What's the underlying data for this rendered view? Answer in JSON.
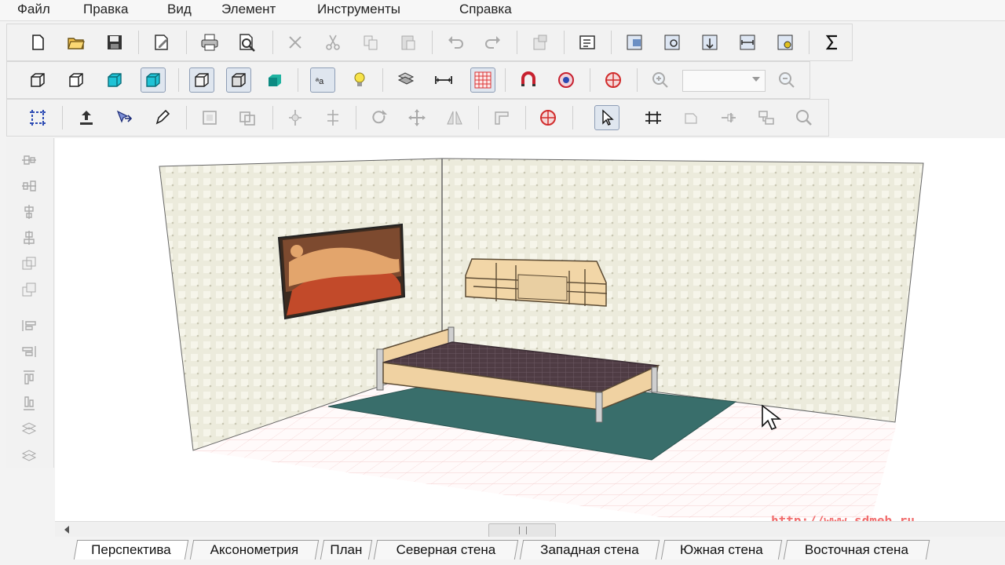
{
  "menu": [
    "Файл",
    "Правка",
    "Вид",
    "Элемент",
    "Инструменты",
    "Справка"
  ],
  "toolbar": {
    "row1_icons": [
      "new-file-icon",
      "open-folder-icon",
      "save-icon",
      "edit-document-icon",
      "print-icon",
      "print-preview-icon",
      "delete-icon",
      "cut-icon",
      "copy-icon",
      "paste-icon",
      "undo-icon",
      "redo-icon",
      "properties-icon",
      "report-icon",
      "view-icon-1",
      "view-icon-2",
      "view-icon-3",
      "view-icon-4",
      "view-icon-5",
      "sigma-icon"
    ],
    "row2_icons": [
      "wireframe-box-icon",
      "box-icon",
      "shaded-box-icon",
      "textured-box-icon",
      "box-outline-icon",
      "box-wire-icon",
      "solid-box-icon",
      "text-label-icon",
      "light-bulb-icon",
      "material-icon",
      "dimension-icon",
      "grid-icon",
      "magnet-icon",
      "target-icon",
      "crosshair-icon",
      "zoom-in-icon",
      "zoom-out-icon"
    ],
    "row3_icons": [
      "select-grid-icon",
      "move-up-icon",
      "move-arrow-icon",
      "edit-pen-icon",
      "rect-select-icon",
      "multi-select-icon",
      "align-icon-1",
      "align-icon-2",
      "rotate-icon",
      "move-cross-icon",
      "mirror-icon",
      "corner-icon",
      "snap-target-icon",
      "pointer-icon",
      "dimension-bars-icon",
      "shape-icon",
      "connect-icon",
      "node-icon",
      "search-icon"
    ],
    "zoom_value": ""
  },
  "sidebar_icons": [
    "side-tool-1-icon",
    "side-tool-2-icon",
    "side-tool-3-icon",
    "side-tool-4-icon",
    "side-tool-5-icon",
    "side-tool-6-icon",
    "side-tool-7-icon",
    "side-tool-8-icon",
    "side-tool-9-icon",
    "side-tool-10-icon",
    "side-tool-11-icon",
    "side-tool-12-icon"
  ],
  "tabs": [
    "Перспектива",
    "Аксонометрия",
    "План",
    "Северная стена",
    "Западная стена",
    "Южная стена",
    "Восточная стена"
  ],
  "active_tab": "Перспектива",
  "watermark": "http://www.sdmeb.ru",
  "colors": {
    "wall": "#ecebdc",
    "floor_grid": "#f3c9c9",
    "rug": "#396e6b",
    "bed_frame": "#f0d2a2",
    "mattress": "#4f3c44",
    "shelf": "#f2d6a7",
    "watermark": "#f16d6d"
  }
}
